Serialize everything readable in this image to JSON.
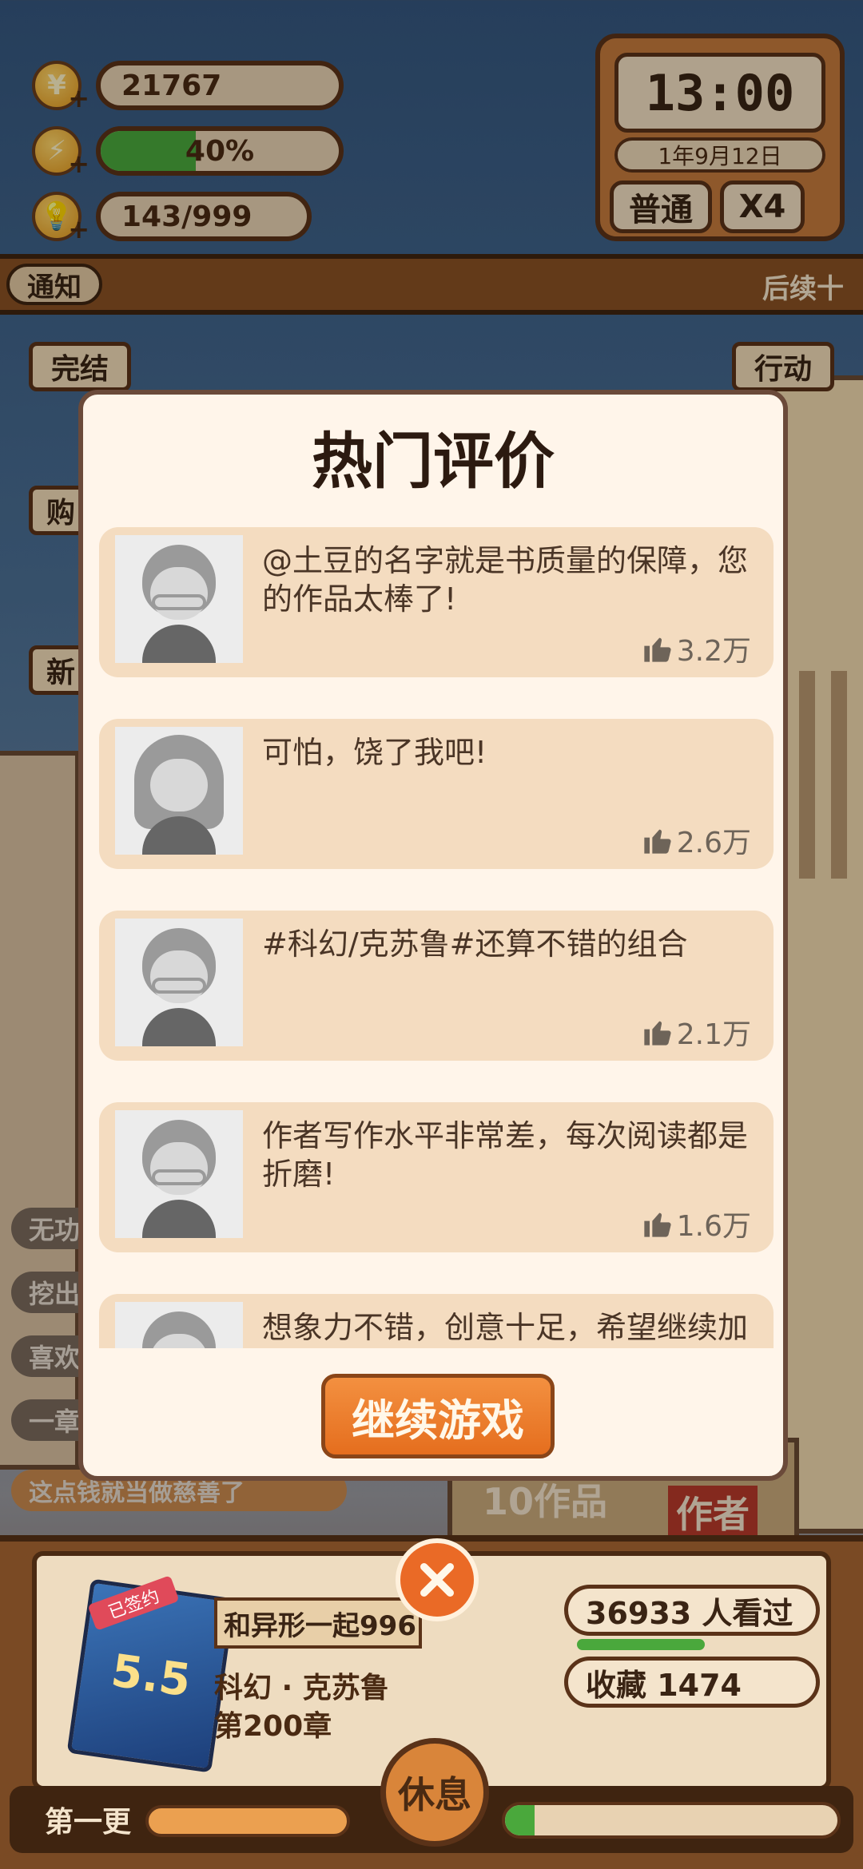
{
  "hud": {
    "coins": "21767",
    "energy": "40%",
    "energy_level": 0.4,
    "ideas": "143/999"
  },
  "clock": {
    "time": "13:00",
    "date": "1年9月12日",
    "mode": "普通",
    "speed": "X4"
  },
  "notice": {
    "tag": "通知",
    "text": "后续十"
  },
  "side_buttons": {
    "finish": "完结",
    "action": "行动",
    "shop": "购",
    "new": "新"
  },
  "side_tags": [
    "无功",
    "挖出",
    "喜欢",
    "一章"
  ],
  "background_text": {
    "banner": "这点钱就当做慈善了",
    "works": "10作品",
    "author": "作者"
  },
  "modal": {
    "title": "热门评价",
    "reviews": [
      {
        "text": "@土豆的名字就是书质量的保障，您的作品太棒了!",
        "likes": "3.2万",
        "avatar": "boy-glasses-icon"
      },
      {
        "text": "可怕，饶了我吧!",
        "likes": "2.6万",
        "avatar": "girl-icon"
      },
      {
        "text": "#科幻/克苏鲁#还算不错的组合",
        "likes": "2.1万",
        "avatar": "boy-glasses-icon"
      },
      {
        "text": "作者写作水平非常差，每次阅读都是折磨!",
        "likes": "1.6万",
        "avatar": "boy-glasses-icon"
      },
      {
        "text": "想象力不错，创意十足，希望继续加油!",
        "likes": "",
        "avatar": "boy-glasses-icon"
      }
    ],
    "continue_label": "继续游戏"
  },
  "book": {
    "badge": "已签约",
    "rating": "5.5",
    "title": "和异形一起996",
    "genre": "科幻 · 克苏鲁",
    "chapter": "第200章",
    "readers": "36933   人看过",
    "favorites": "收藏 1474"
  },
  "bottom": {
    "chapter_label": "第一更",
    "rest_label": "休息",
    "progress": 0.09
  },
  "colors": {
    "accent_orange": "#e56e1e",
    "energy_green": "#4aa83c",
    "wood": "#7a4a24",
    "card": "#f4dcc0"
  }
}
